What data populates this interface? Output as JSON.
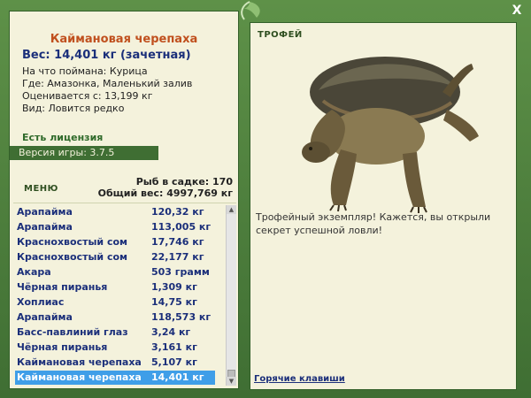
{
  "close_label": "X",
  "left": {
    "fish_name": "Каймановая черепаха",
    "fish_weight": "Вес: 14,401 кг (зачетная)",
    "bait_line": "На что поймана: Курица",
    "location_line": "Где: Амазонка, Маленький залив",
    "price_line": "Оценивается с: 13,199 кг",
    "kind_line": "Вид: Ловится редко",
    "license": "Есть лицензия",
    "version": "Версия игры: 3.7.5",
    "menu": "МЕНЮ",
    "fish_count": "Рыб в садке: 170",
    "total_weight": "Общий вес: 4997,769 кг",
    "catch": [
      {
        "name": "Арапайма",
        "weight": "120,32 кг"
      },
      {
        "name": "Арапайма",
        "weight": "113,005 кг"
      },
      {
        "name": "Краснохвостый сом",
        "weight": "17,746 кг"
      },
      {
        "name": "Краснохвостый сом",
        "weight": "22,177 кг"
      },
      {
        "name": "Акара",
        "weight": "503 грамм"
      },
      {
        "name": "Чёрная пиранья",
        "weight": "1,309 кг"
      },
      {
        "name": "Хоплиас",
        "weight": "14,75 кг"
      },
      {
        "name": "Арапайма",
        "weight": "118,573 кг"
      },
      {
        "name": "Басс-павлиний глаз",
        "weight": "3,24 кг"
      },
      {
        "name": "Чёрная пиранья",
        "weight": "3,161 кг"
      },
      {
        "name": "Каймановая черепаха",
        "weight": "5,107 кг"
      },
      {
        "name": "Каймановая черепаха",
        "weight": "14,401 кг"
      }
    ]
  },
  "right": {
    "trophy_label": "ТРОФЕЙ",
    "trophy_text": "Трофейный экземпляр! Кажется, вы открыли секрет успешной ловли!",
    "hotkeys": "Горячие клавиши"
  },
  "colors": {
    "frame": "#4a7a3c",
    "panel": "#f4f2dc",
    "title": "#c0501e",
    "list_text": "#1b2f7a",
    "selected": "#3f9ee8"
  }
}
